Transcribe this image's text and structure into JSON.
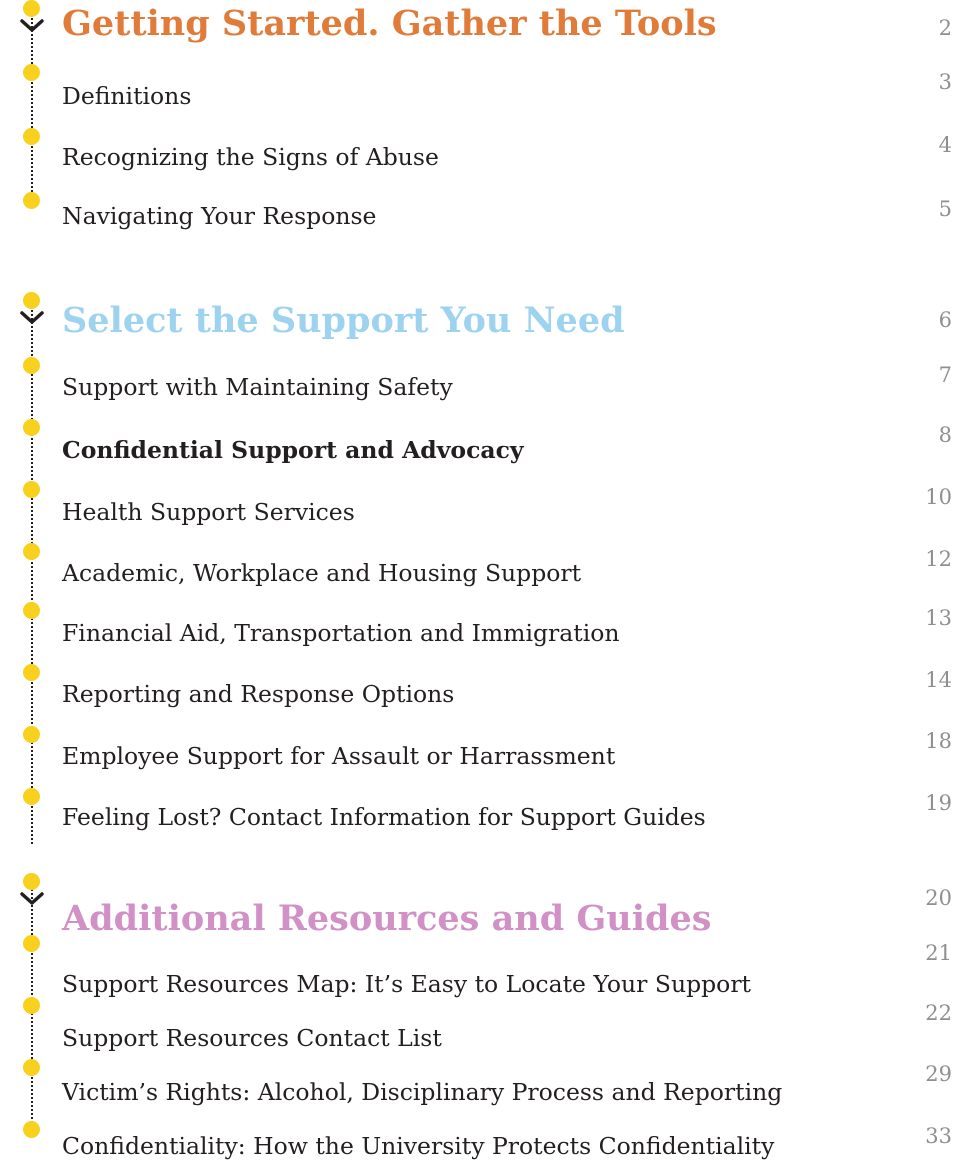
{
  "colors": {
    "accent_dot": "#f7d11e",
    "page_number": "#8f8f8f",
    "body_text": "#231f20"
  },
  "sections": [
    {
      "heading": "Getting Started. Gather the Tools",
      "color": "#e07b39",
      "page": "2",
      "items": [
        {
          "label": "Definitions",
          "page": "3"
        },
        {
          "label": "Recognizing the Signs of Abuse",
          "page": "4"
        },
        {
          "label": "Navigating Your Response",
          "page": "5"
        }
      ]
    },
    {
      "heading": "Select the Support You Need",
      "color": "#9dd3ef",
      "page": "6",
      "items": [
        {
          "label": "Support with Maintaining Safety",
          "page": "7"
        },
        {
          "label": "Confidential Support and Advocacy",
          "page": "8",
          "bold": true
        },
        {
          "label": "Health Support Services",
          "page": "10"
        },
        {
          "label": "Academic, Workplace and Housing Support",
          "page": "12"
        },
        {
          "label": "Financial Aid, Transportation and Immigration",
          "page": "13"
        },
        {
          "label": "Reporting and Response Options",
          "page": "14"
        },
        {
          "label": "Employee Support for Assault or Harrassment",
          "page": "18"
        },
        {
          "label": "Feeling Lost? Contact Information for Support Guides",
          "page": "19"
        }
      ]
    },
    {
      "heading": "Additional Resources and Guides",
      "color": "#d291c6",
      "page": "20",
      "items": [
        {
          "label": "Support Resources Map: It’s Easy to Locate Your Support",
          "page": "21"
        },
        {
          "label": "Support Resources Contact List",
          "page": "22"
        },
        {
          "label": "Victim’s Rights: Alcohol, Disciplinary Process and Reporting",
          "page": "29"
        },
        {
          "label": "Confidentiality: How the University Protects Confidentiality",
          "page": "33"
        }
      ]
    }
  ]
}
